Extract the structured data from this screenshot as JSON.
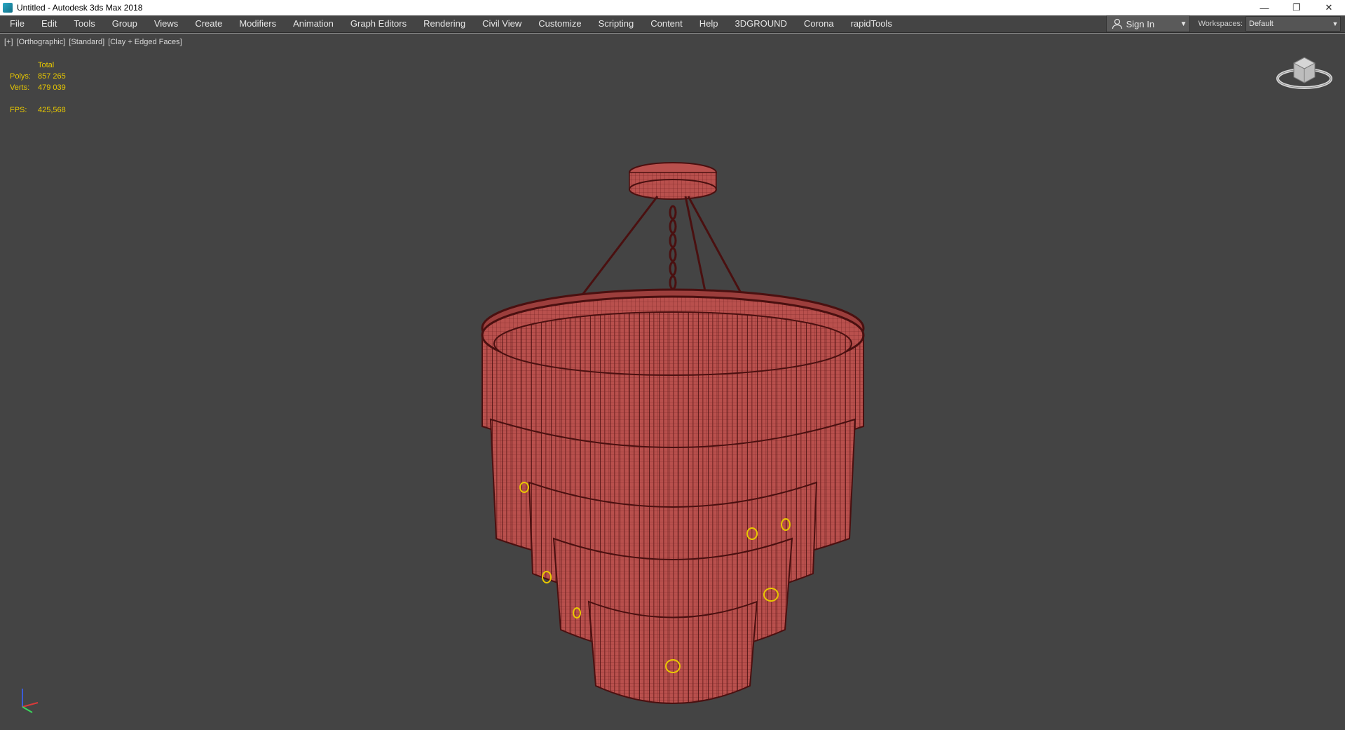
{
  "window": {
    "title": "Untitled - Autodesk 3ds Max 2018",
    "controls": [
      "—",
      "❐",
      "✕"
    ]
  },
  "menubar": {
    "items": [
      "File",
      "Edit",
      "Tools",
      "Group",
      "Views",
      "Create",
      "Modifiers",
      "Animation",
      "Graph Editors",
      "Rendering",
      "Civil View",
      "Customize",
      "Scripting",
      "Content",
      "Help",
      "3DGROUND",
      "Corona",
      "rapidTools"
    ],
    "signin_label": "Sign In",
    "workspaces_label": "Workspaces:",
    "workspace_value": "Default"
  },
  "viewport": {
    "label_plus": "[+]",
    "label_view": "[Orthographic]",
    "label_shading": "[Standard]",
    "label_style": "[Clay + Edged Faces]",
    "stats": {
      "total_label": "Total",
      "polys_label": "Polys:",
      "polys_value": "857 265",
      "verts_label": "Verts:",
      "verts_value": "479 039",
      "fps_label": "FPS:",
      "fps_value": "425,568"
    }
  },
  "icons": {
    "app": "3dsmax-app-icon",
    "user": "user-icon",
    "viewcube": "viewcube-icon",
    "axis": "axis-tripod-icon"
  },
  "colors": {
    "viewport_bg": "#444444",
    "stats_text": "#e8c800",
    "model_fill": "#b9504d",
    "wire": "#5a1414"
  }
}
